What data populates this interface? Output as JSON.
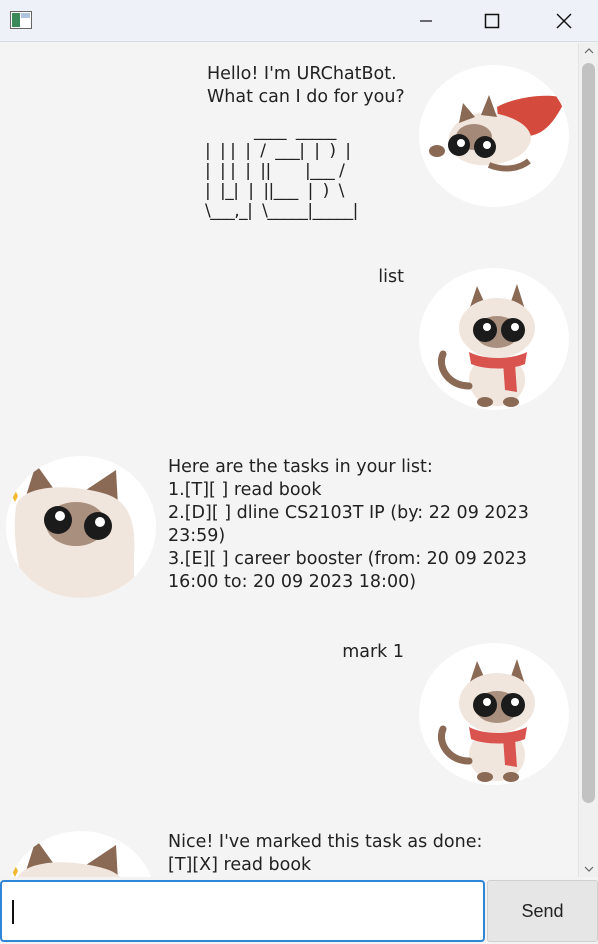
{
  "window": {
    "icons": {
      "app": "app-window-icon",
      "minimize": "minimize-icon",
      "maximize": "maximize-icon",
      "close": "close-icon"
    }
  },
  "messages": [
    {
      "sender": "bot",
      "text": "Hello! I'm URChatBot.\nWhat can I do for you?",
      "ascii": "          ____  _____\n|  | |  |  /  ___|  |  )  |\n|  | |  |  ||       |___ /\n|  |_|  |  ||___  |  )  \\\n\\___,_|  \\_____|_____|",
      "avatar": "flying-cat-avatar"
    },
    {
      "sender": "user",
      "text": "list",
      "avatar": "scarf-cat-avatar"
    },
    {
      "sender": "bot",
      "text": "Here are the tasks in your list:\n1.[T][ ] read book\n2.[D][ ] dline CS2103T IP (by: 22 09 2023\n23:59)\n3.[E][ ] career booster (from: 20 09 2023\n16:00 to: 20 09 2023 18:00)",
      "avatar": "peeking-cat-avatar"
    },
    {
      "sender": "user",
      "text": "mark 1",
      "avatar": "scarf-cat-avatar"
    },
    {
      "sender": "bot",
      "text": "Nice! I've marked this task as done:\n[T][X] read book",
      "avatar": "peeking-cat-avatar"
    }
  ],
  "input": {
    "value": "",
    "placeholder": ""
  },
  "send": {
    "label": "Send"
  },
  "colors": {
    "accent": "#2f86d6",
    "background": "#f4f4f4",
    "scarf": "#d9534f",
    "cape": "#d44a3c"
  }
}
